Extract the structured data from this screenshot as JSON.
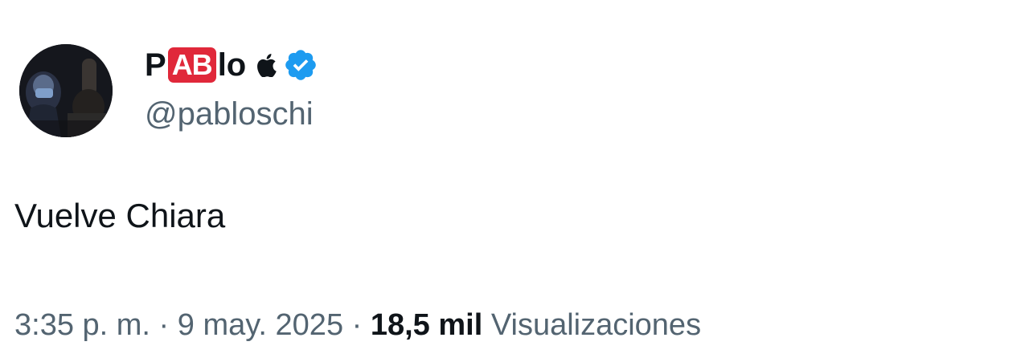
{
  "author": {
    "name_prefix": "P",
    "name_badge": "AB",
    "name_suffix": "lo",
    "handle": "@pabloschi",
    "avatar_icon": "avatar",
    "apple_icon": "apple-icon",
    "verified_icon": "verified-badge-icon",
    "badge_color": "#e0283a",
    "verified_color": "#1d9bf0"
  },
  "tweet": {
    "text": "Vuelve Chiara"
  },
  "meta": {
    "time": "3:35 p. m.",
    "separator1": " · ",
    "date": "9 may. 2025",
    "separator2": " · ",
    "views_count": "18,5 mil",
    "views_label": " Visualizaciones"
  }
}
